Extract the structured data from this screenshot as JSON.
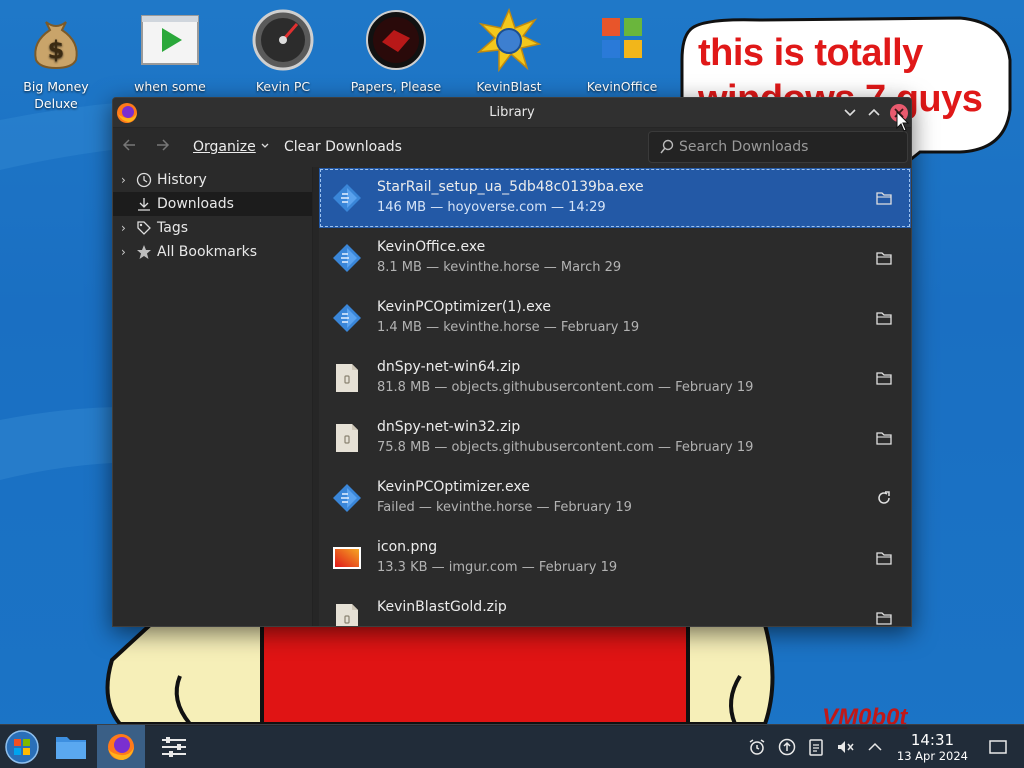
{
  "desktop": {
    "icons": [
      {
        "label_line1": "Big Money",
        "label_line2": "Deluxe",
        "icon": "money-bag-icon"
      },
      {
        "label_line1": "when some",
        "label_line2": "",
        "icon": "video-play-icon"
      },
      {
        "label_line1": "Kevin PC",
        "label_line2": "",
        "icon": "speedometer-icon"
      },
      {
        "label_line1": "Papers, Please",
        "label_line2": "",
        "icon": "papers-please-icon"
      },
      {
        "label_line1": "KevinBlast",
        "label_line2": "",
        "icon": "starburst-disc-icon"
      },
      {
        "label_line1": "KevinOffice",
        "label_line2": "",
        "icon": "office-logo-icon"
      }
    ],
    "bubble_text_line1": "this is totally",
    "bubble_text_line2": "windows 7 guys",
    "signature": "VM0b0t"
  },
  "window": {
    "title": "Library",
    "toolbar": {
      "organize_label": "Organize",
      "clear_label": "Clear Downloads",
      "search_placeholder": "Search Downloads"
    },
    "sidebar": [
      {
        "label": "History",
        "icon": "clock-icon",
        "expandable": true
      },
      {
        "label": "Downloads",
        "icon": "download-icon",
        "expandable": false,
        "active": true
      },
      {
        "label": "Tags",
        "icon": "tag-icon",
        "expandable": true
      },
      {
        "label": "All Bookmarks",
        "icon": "star-icon",
        "expandable": true
      }
    ],
    "downloads": [
      {
        "name": "StarRail_setup_ua_5db48c0139ba.exe",
        "meta": "146 MB — hoyoverse.com — 14:29",
        "icon": "exe-icon",
        "action": "folder-icon",
        "selected": true
      },
      {
        "name": "KevinOffice.exe",
        "meta": "8.1 MB — kevinthe.horse — March 29",
        "icon": "exe-icon",
        "action": "folder-icon"
      },
      {
        "name": "KevinPCOptimizer(1).exe",
        "meta": "1.4 MB — kevinthe.horse — February 19",
        "icon": "exe-icon",
        "action": "folder-icon"
      },
      {
        "name": "dnSpy-net-win64.zip",
        "meta": "81.8 MB — objects.githubusercontent.com — February 19",
        "icon": "zip-icon",
        "action": "folder-icon"
      },
      {
        "name": "dnSpy-net-win32.zip",
        "meta": "75.8 MB — objects.githubusercontent.com — February 19",
        "icon": "zip-icon",
        "action": "folder-icon"
      },
      {
        "name": "KevinPCOptimizer.exe",
        "meta": "Failed — kevinthe.horse — February 19",
        "icon": "exe-icon",
        "action": "retry-icon"
      },
      {
        "name": "icon.png",
        "meta": "13.3 KB — imgur.com — February 19",
        "icon": "image-icon",
        "action": "folder-icon"
      },
      {
        "name": "KevinBlastGold.zip",
        "meta": "",
        "icon": "zip-icon",
        "action": "folder-icon"
      }
    ]
  },
  "taskbar": {
    "time": "14:31",
    "date": "13 Apr 2024"
  },
  "colors": {
    "selection": "#2359a6",
    "window_bg": "#2a2a2a",
    "desktop_blue": "#1f78c8"
  }
}
